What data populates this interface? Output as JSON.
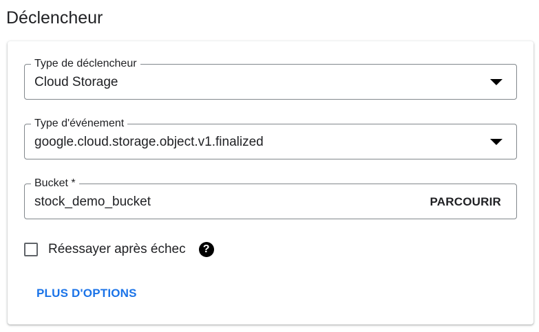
{
  "section": {
    "title": "Déclencheur"
  },
  "trigger_type": {
    "label": "Type de déclencheur",
    "value": "Cloud Storage"
  },
  "event_type": {
    "label": "Type d'événement",
    "value": "google.cloud.storage.object.v1.finalized"
  },
  "bucket": {
    "label": "Bucket *",
    "value": "stock_demo_bucket",
    "browse_label": "PARCOURIR"
  },
  "retry": {
    "label": "Réessayer après échec",
    "checked": false,
    "help_icon": "question-circle-icon",
    "help_glyph": "?"
  },
  "more_options": {
    "label": "PLUS D'OPTIONS"
  },
  "colors": {
    "link": "#1a73e8",
    "border": "#80868b",
    "text": "#202124"
  }
}
